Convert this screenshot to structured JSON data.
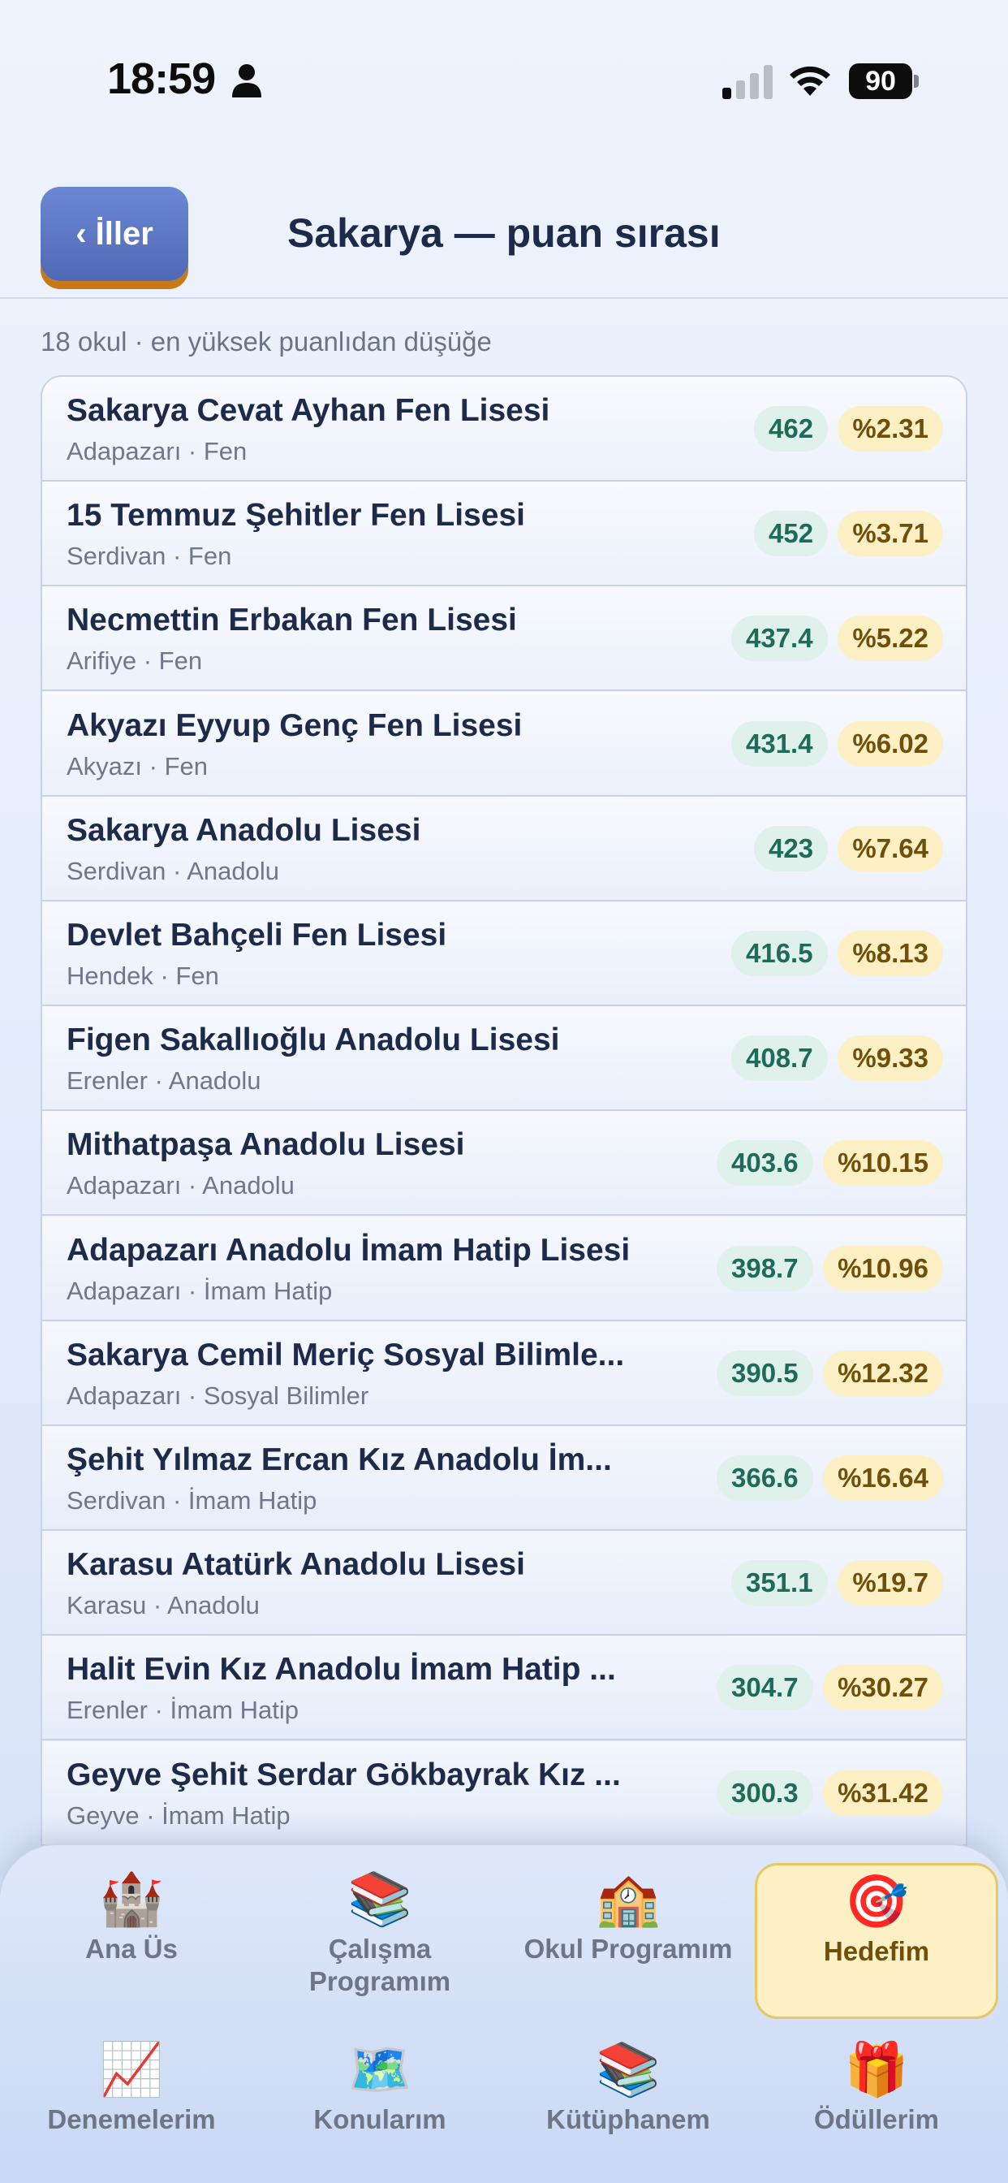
{
  "status_bar": {
    "time": "18:59",
    "battery": "90",
    "icons": [
      "person-icon",
      "signal-icon",
      "wifi-icon",
      "battery-icon"
    ]
  },
  "header": {
    "back_label": "‹ İller",
    "title": "Sakarya — puan sırası"
  },
  "summary": "18 okul · en yüksek puanlıdan düşüğe",
  "schools": [
    {
      "name": "Sakarya Cevat Ayhan Fen Lisesi",
      "sub": "Adapazarı · Fen",
      "score": "462",
      "pct": "%2.31"
    },
    {
      "name": "15 Temmuz Şehitler Fen Lisesi",
      "sub": "Serdivan · Fen",
      "score": "452",
      "pct": "%3.71"
    },
    {
      "name": "Necmettin Erbakan Fen Lisesi",
      "sub": "Arifiye · Fen",
      "score": "437.4",
      "pct": "%5.22"
    },
    {
      "name": "Akyazı Eyyup Genç Fen Lisesi",
      "sub": "Akyazı · Fen",
      "score": "431.4",
      "pct": "%6.02"
    },
    {
      "name": "Sakarya Anadolu Lisesi",
      "sub": "Serdivan · Anadolu",
      "score": "423",
      "pct": "%7.64"
    },
    {
      "name": "Devlet Bahçeli Fen Lisesi",
      "sub": "Hendek · Fen",
      "score": "416.5",
      "pct": "%8.13"
    },
    {
      "name": "Figen Sakallıoğlu Anadolu Lisesi",
      "sub": "Erenler · Anadolu",
      "score": "408.7",
      "pct": "%9.33"
    },
    {
      "name": "Mithatpaşa Anadolu Lisesi",
      "sub": "Adapazarı · Anadolu",
      "score": "403.6",
      "pct": "%10.15"
    },
    {
      "name": "Adapazarı Anadolu İmam Hatip Lisesi",
      "sub": "Adapazarı · İmam Hatip",
      "score": "398.7",
      "pct": "%10.96"
    },
    {
      "name": "Sakarya Cemil Meriç Sosyal Bilimle...",
      "sub": "Adapazarı · Sosyal Bilimler",
      "score": "390.5",
      "pct": "%12.32"
    },
    {
      "name": "Şehit Yılmaz Ercan Kız Anadolu İm...",
      "sub": "Serdivan · İmam Hatip",
      "score": "366.6",
      "pct": "%16.64"
    },
    {
      "name": "Karasu Atatürk Anadolu Lisesi",
      "sub": "Karasu · Anadolu",
      "score": "351.1",
      "pct": "%19.7"
    },
    {
      "name": "Halit Evin Kız Anadolu İmam Hatip ...",
      "sub": "Erenler · İmam Hatip",
      "score": "304.7",
      "pct": "%30.27"
    },
    {
      "name": "Geyve Şehit Serdar Gökbayrak Kız ...",
      "sub": "Geyve · İmam Hatip",
      "score": "300.3",
      "pct": "%31.42"
    }
  ],
  "nav": [
    {
      "label": "Ana Üs",
      "icon": "🏰",
      "icon_name": "castle-icon",
      "active": false
    },
    {
      "label": "Çalışma\nProgramım",
      "icon": "📚",
      "icon_name": "books-icon",
      "active": false
    },
    {
      "label": "Okul Programım",
      "icon": "🏫",
      "icon_name": "school-icon",
      "active": false
    },
    {
      "label": "Hedefim",
      "icon": "🎯",
      "icon_name": "target-icon",
      "active": true
    },
    {
      "label": "Denemelerim",
      "icon": "📈",
      "icon_name": "chart-icon",
      "active": false
    },
    {
      "label": "Konularım",
      "icon": "🗺️",
      "icon_name": "map-icon",
      "active": false
    },
    {
      "label": "Kütüphanem",
      "icon": "📚",
      "icon_name": "library-icon",
      "active": false
    },
    {
      "label": "Ödüllerim",
      "icon": "🎁",
      "icon_name": "gift-icon",
      "active": false
    }
  ]
}
